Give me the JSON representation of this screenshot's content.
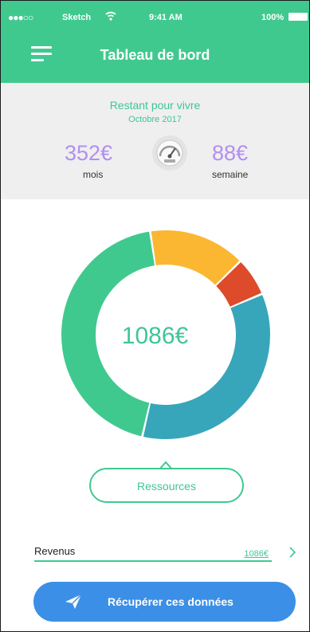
{
  "status_bar": {
    "signal": "●●●○○",
    "carrier": "Sketch",
    "time": "9:41 AM",
    "battery": "100%"
  },
  "header": {
    "title": "Tableau de bord",
    "menu_icon": "hamburger-icon"
  },
  "summary": {
    "title": "Restant pour vivre",
    "month": "Octobre 2017",
    "monthly_amount": "352€",
    "monthly_label": "mois",
    "weekly_amount": "88€",
    "weekly_label": "semaine",
    "gauge_icon": "speedometer-icon"
  },
  "donut": {
    "total": "1086€",
    "segments": [
      {
        "name": "teal",
        "color": "#40c98f",
        "fraction": 0.44
      },
      {
        "name": "yellow",
        "color": "#fbb731",
        "fraction": 0.15
      },
      {
        "name": "red",
        "color": "#dd4b2a",
        "fraction": 0.06
      },
      {
        "name": "blue",
        "color": "#37a6ba",
        "fraction": 0.35
      }
    ]
  },
  "callout": {
    "label": "Ressources"
  },
  "revenus": {
    "label": "Revenus",
    "value": "1086€",
    "chevron_icon": "chevron-right-icon"
  },
  "cta": {
    "label": "Récupérer ces données",
    "icon": "send-icon"
  },
  "colors": {
    "primary": "#40c98f",
    "accent_purple": "#b28ff0",
    "button_blue": "#3b8fe6"
  }
}
